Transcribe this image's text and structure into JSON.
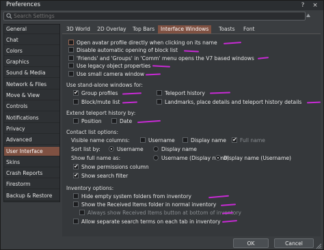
{
  "window": {
    "title": "Preferences",
    "help_glyph": "?",
    "close_glyph": "×"
  },
  "search": {
    "placeholder": "Search Settings"
  },
  "sidebar": {
    "items": [
      {
        "label": "General"
      },
      {
        "label": "Chat"
      },
      {
        "label": "Colors"
      },
      {
        "label": "Graphics"
      },
      {
        "label": "Sound & Media"
      },
      {
        "label": "Network & Files"
      },
      {
        "label": "Move & View"
      },
      {
        "label": "Controls"
      },
      {
        "label": "Notifications"
      },
      {
        "label": "Privacy"
      },
      {
        "label": "Advanced"
      },
      {
        "label": "User Interface"
      },
      {
        "label": "Skins"
      },
      {
        "label": "Crash Reports"
      },
      {
        "label": "Firestorm"
      },
      {
        "label": "Backup & Restore"
      }
    ],
    "active_index": 11
  },
  "tabs": [
    {
      "label": "3D World"
    },
    {
      "label": "2D Overlay"
    },
    {
      "label": "Top Bars"
    },
    {
      "label": "Interface Windows"
    },
    {
      "label": "Toasts"
    },
    {
      "label": "Font"
    }
  ],
  "options": {
    "open_avatar_profile": "Open avatar profile directly when clicking on its name",
    "disable_block_list": "Disable automatic opening of block list",
    "friends_groups": "'Friends' and 'Groups' in 'Comm' menu opens the V7 based windows",
    "legacy_props": "Use legacy object properties",
    "small_camera": "Use small camera window"
  },
  "standalone": {
    "heading": "Use stand-alone windows for:",
    "group_profiles": "Group profiles",
    "teleport_history": "Teleport history",
    "block_mute": "Block/mute list",
    "landmarks": "Landmarks, place details and teleport history details"
  },
  "extend": {
    "heading": "Extend teleport history by:",
    "position": "Position",
    "date": "Date"
  },
  "contact": {
    "heading": "Contact list options:",
    "visible_cols": "Visible name columns:",
    "username": "Username",
    "display_name": "Display name",
    "full_name": "Full name",
    "sort_by": "Sort list by:",
    "show_full_as": "Show full name as:",
    "user_display": "Username (Display name)",
    "display_user": "Display name (Username)",
    "show_perm": "Show permissions column",
    "show_search": "Show search filter"
  },
  "inventory": {
    "heading": "Inventory options:",
    "hide_empty": "Hide empty system folders from inventory",
    "show_received": "Show the Received Items folder in normal inventory",
    "always_show_received": "Always show Received Items button at bottom of inventory",
    "separate_search": "Allow separate search terms on each tab in inventory"
  },
  "buttons": {
    "ok": "OK",
    "cancel": "Cancel"
  },
  "colors": {
    "accent": "#7f5142",
    "annotation": "#c92ad6"
  }
}
